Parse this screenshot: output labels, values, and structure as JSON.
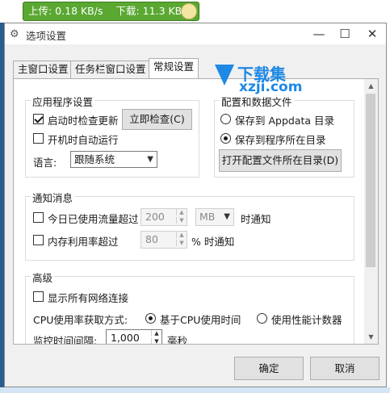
{
  "speedbar": {
    "upload": "上传: 0.18 KB/s",
    "download": "下载: 11.3 KB/s"
  },
  "window": {
    "title": "选项设置",
    "icon": "gear-icon"
  },
  "tabs": [
    {
      "label": "主窗口设置",
      "active": false
    },
    {
      "label": "任务栏窗口设置",
      "active": false
    },
    {
      "label": "常规设置",
      "active": true
    }
  ],
  "app_settings": {
    "heading": "应用程序设置",
    "check_update": {
      "label": "启动时检查更新",
      "checked": true
    },
    "check_now_button": "立即检查(C)",
    "auto_run": {
      "label": "开机时自动运行",
      "checked": false
    },
    "language_label": "语言:",
    "language_value": "跟随系统"
  },
  "config": {
    "heading": "配置和数据文件",
    "save_appdata": {
      "label": "保存到 Appdata 目录",
      "checked": false
    },
    "save_program": {
      "label": "保存到程序所在目录",
      "checked": true
    },
    "open_dir_button": "打开配置文件所在目录(D)"
  },
  "notify": {
    "heading": "通知消息",
    "traffic": {
      "label": "今日已使用流量超过",
      "checked": false,
      "value": "200",
      "unit": "MB",
      "suffix": "时通知"
    },
    "memory": {
      "label": "内存利用率超过",
      "checked": false,
      "value": "80",
      "suffix": "% 时通知"
    }
  },
  "advanced": {
    "heading": "高级",
    "show_all": {
      "label": "显示所有网络连接",
      "checked": false
    },
    "cpu_label": "CPU使用率获取方式:",
    "cpu_opt1": {
      "label": "基于CPU使用时间",
      "checked": true
    },
    "cpu_opt2": {
      "label": "使用性能计数器",
      "checked": false
    },
    "interval_label": "监控时间间隔:",
    "interval_value": "1,000",
    "interval_unit": "毫秒"
  },
  "buttons": {
    "ok": "确定",
    "cancel": "取消"
  },
  "watermark": {
    "title": "下载集",
    "sub": "xzji.com"
  },
  "colors": {
    "speedbar": "#5aa832",
    "accent": "#1e88e5"
  }
}
